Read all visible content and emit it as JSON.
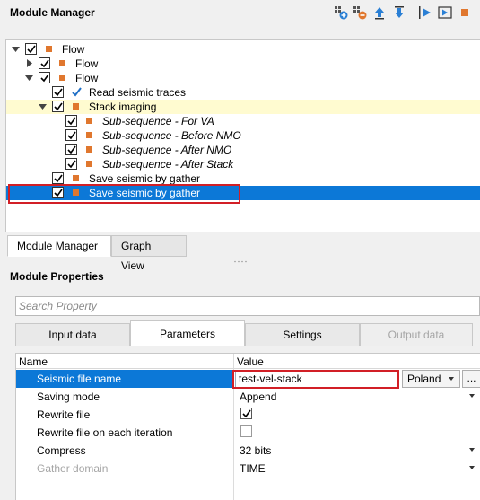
{
  "module_manager": {
    "title": "Module Manager",
    "toolbar": [
      {
        "name": "add-module-icon"
      },
      {
        "name": "remove-module-icon"
      },
      {
        "name": "move-up-icon"
      },
      {
        "name": "move-down-icon"
      },
      {
        "name": "run-icon"
      },
      {
        "name": "run-step-icon"
      },
      {
        "name": "stop-icon"
      }
    ],
    "tree": [
      {
        "label": "Flow",
        "marker": "square"
      },
      {
        "label": "Flow",
        "marker": "square"
      },
      {
        "label": "Flow",
        "marker": "square"
      },
      {
        "label": "Read seismic traces",
        "marker": "check"
      },
      {
        "label": "Stack imaging",
        "marker": "square"
      },
      {
        "label": "Sub-sequence - For VA",
        "marker": "square"
      },
      {
        "label": "Sub-sequence - Before NMO",
        "marker": "square"
      },
      {
        "label": "Sub-sequence - After NMO",
        "marker": "square"
      },
      {
        "label": "Sub-sequence - After Stack",
        "marker": "square"
      },
      {
        "label": "Save seismic by gather",
        "marker": "square"
      },
      {
        "label": "Save seismic by gather",
        "marker": "square"
      }
    ],
    "tabs": [
      "Module Manager",
      "Graph View"
    ]
  },
  "module_properties": {
    "title": "Module Properties",
    "search_placeholder": "Search Property",
    "tabs": [
      "Input data",
      "Parameters",
      "Settings",
      "Output data"
    ],
    "headers": {
      "name": "Name",
      "value": "Value"
    },
    "rows": [
      {
        "name": "Seismic file name",
        "value": "test-vel-stack",
        "locale": "Poland",
        "ellipsis": "..."
      },
      {
        "name": "Saving mode",
        "value": "Append"
      },
      {
        "name": "Rewrite file",
        "checked": true
      },
      {
        "name": "Rewrite file on each iteration",
        "checked": false
      },
      {
        "name": "Compress",
        "value": "32 bits"
      },
      {
        "name": "Gather domain",
        "value": "TIME"
      }
    ]
  },
  "colors": {
    "accent_selection": "#0c78d7",
    "module_marker": "#e0772e",
    "highlight_box": "#d21f26",
    "active_row": "#fffbd0"
  }
}
